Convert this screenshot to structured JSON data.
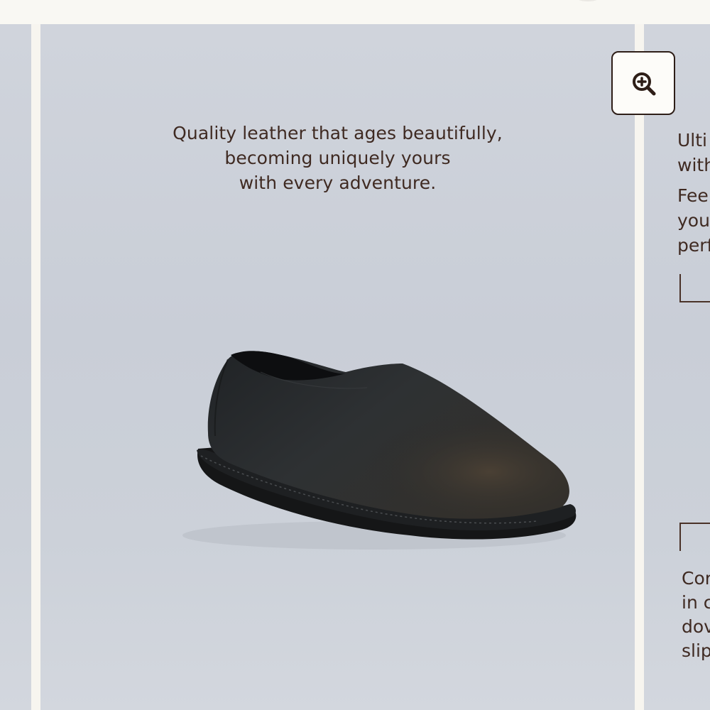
{
  "gallery": {
    "current_slide": {
      "caption_lines": [
        "Quality leather that ages beautifully,",
        "becoming uniquely yours",
        "with every adventure."
      ],
      "image_subject": "black leather slip-on shoe"
    },
    "next_slide": {
      "caption_lines": [
        "Ulti",
        "with"
      ],
      "caption2_lines": [
        "Fee",
        "you",
        "perf"
      ],
      "bottom_caption_lines": [
        "Cor",
        "in c",
        "dov",
        "slip"
      ]
    },
    "zoom_button": {
      "icon": "zoom-in-icon"
    }
  },
  "colors": {
    "text": "#3f2a22",
    "slide_background": "#cdd1d9",
    "page_background": "#f7f5ef"
  }
}
